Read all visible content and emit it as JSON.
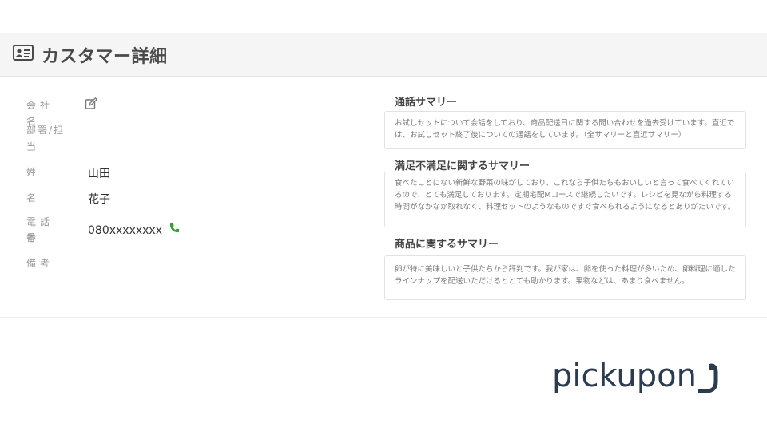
{
  "header": {
    "title": "カスタマー詳細",
    "icon": "id-card-icon"
  },
  "customer": {
    "company_label": "会社名",
    "department_label_line1": "部署/担",
    "department_label_line2": "当",
    "last_name_label": "姓",
    "last_name_value": "山田",
    "first_name_label": "名",
    "first_name_value": "花子",
    "phone_label_line1": "電話番",
    "phone_label_line2": "号",
    "phone_value": "080xxxxxxxx",
    "notes_label": "備考"
  },
  "summaries": {
    "call": {
      "title": "通話サマリー",
      "body": "お試しセットについて会話をしており、商品配送日に関する問い合わせを過去受けています。直近では、お試しセット終了後についての通話をしています。（全サマリーと直近サマリー）"
    },
    "satisfaction": {
      "title": "満足不満足に関するサマリー",
      "body": "食べたことにない新鮮な野菜の味がしており、これなら子供たちもおいしいと言って食べてくれているので、とても満足しております。定期宅配Mコースで継続したいです。レシピを見ながら料理する時間がなかなか取れなく、料理セットのようなものですぐ食べられるようになるとありがたいです。"
    },
    "product": {
      "title": "商品に関するサマリー",
      "body": "卵が特に美味しいと子供たちから評判です。我が家は、卵を使った料理が多いため、卵料理に適したラインナップを配送いただけるととても助かります。果物などは、あまり食べません。"
    }
  },
  "logo": {
    "text": "pickupon",
    "brand_color": "#2d3b4e"
  },
  "colors": {
    "phone_icon": "#3a9a3a",
    "header_bg": "#f5f5f5"
  }
}
